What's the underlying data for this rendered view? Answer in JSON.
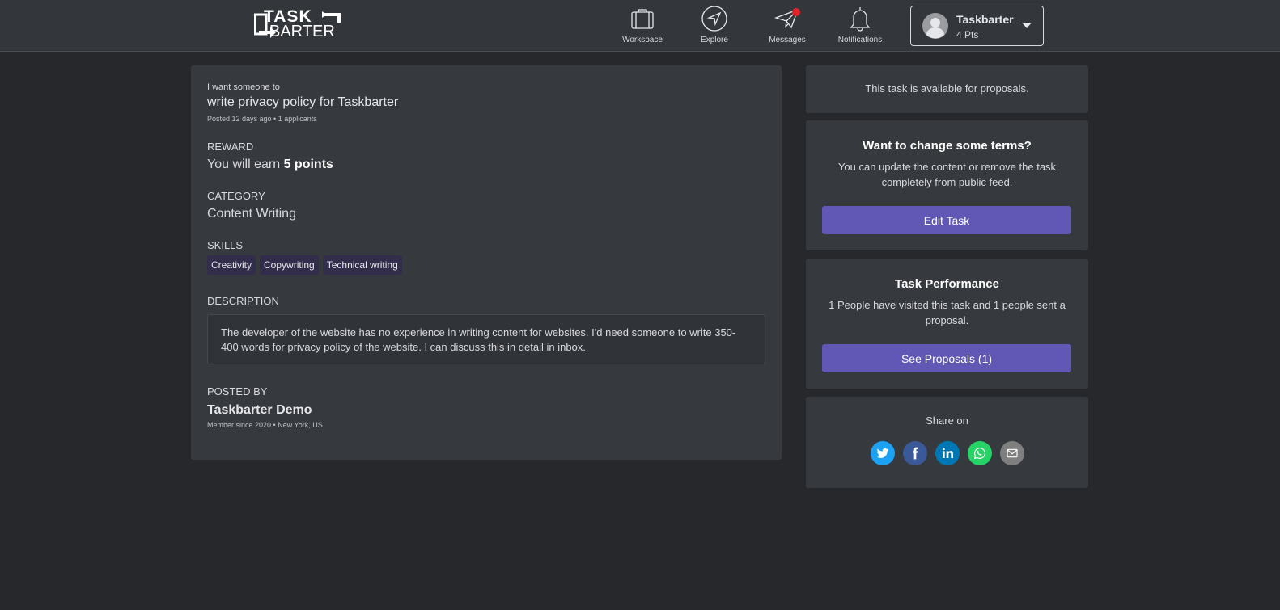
{
  "header": {
    "logo_text_top": "TASK",
    "logo_text_bottom": "BARTER",
    "nav": [
      {
        "label": "Workspace",
        "icon": "briefcase-icon"
      },
      {
        "label": "Explore",
        "icon": "compass-icon"
      },
      {
        "label": "Messages",
        "icon": "paper-plane-icon"
      },
      {
        "label": "Notifications",
        "icon": "bell-icon"
      }
    ],
    "user": {
      "name": "Taskbarter",
      "points": "4 Pts"
    }
  },
  "task": {
    "kicker": "I want someone to",
    "title": "write privacy policy for Taskbarter",
    "posted_meta": "Posted 12 days ago • 1 applicants",
    "reward_label": "REWARD",
    "reward_prefix": "You will earn ",
    "reward_value": "5 points",
    "category_label": "CATEGORY",
    "category_value": "Content Writing",
    "skills_label": "SKILLS",
    "skills": [
      "Creativity",
      "Copywriting",
      "Technical writing"
    ],
    "description_label": "DESCRIPTION",
    "description": "The developer of the website has no experience in writing content for websites. I'd need someone to write 350-400 words for privacy policy of the website. I can discuss this in detail in inbox.",
    "posted_by_label": "POSTED BY",
    "poster_name": "Taskbarter Demo",
    "poster_meta": "Member since 2020 • New York, US"
  },
  "sidebar": {
    "status_text": "This task is available for proposals.",
    "terms": {
      "heading": "Want to change some terms?",
      "text": "You can update the content or remove the task completely from public feed.",
      "button": "Edit Task"
    },
    "performance": {
      "heading": "Task Performance",
      "text": "1 People have visited this task and 1 people sent a proposal.",
      "button": "See Proposals (1)"
    },
    "share": {
      "label": "Share on",
      "buttons": [
        {
          "icon": "twitter-icon",
          "color": "#1da1f2"
        },
        {
          "icon": "facebook-icon",
          "color": "#3b5998"
        },
        {
          "icon": "linkedin-icon",
          "color": "#0077b5"
        },
        {
          "icon": "whatsapp-icon",
          "color": "#25d366"
        },
        {
          "icon": "email-icon",
          "color": "#7f7f7f"
        }
      ]
    }
  },
  "colors": {
    "background": "#26282c",
    "card": "#36393e",
    "accent": "#6157b4",
    "notification_dot": "#e3222a"
  }
}
